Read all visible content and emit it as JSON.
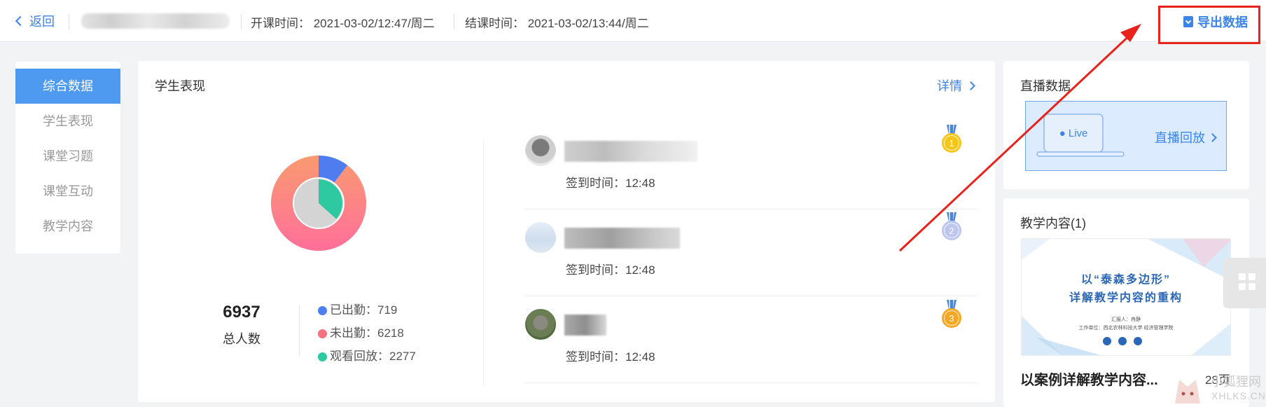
{
  "header": {
    "back_label": "返回",
    "start_time": "开课时间： 2021-03-02/12:47/周二",
    "end_time": "结课时间： 2021-03-02/13:44/周二",
    "export_label": "导出数据"
  },
  "sidebar": {
    "items": [
      {
        "label": "综合数据",
        "active": true
      },
      {
        "label": "学生表现",
        "active": false
      },
      {
        "label": "课堂习题",
        "active": false
      },
      {
        "label": "课堂互动",
        "active": false
      },
      {
        "label": "教学内容",
        "active": false
      }
    ]
  },
  "performance": {
    "title": "学生表现",
    "detail_label": "详情",
    "total_count": "6937",
    "total_label": "总人数",
    "legend": [
      {
        "label": "已出勤：719",
        "color": "#4f7df0"
      },
      {
        "label": "未出勤：6218",
        "color": "#f4727f"
      },
      {
        "label": "观看回放：2277",
        "color": "#2fc9a1"
      }
    ],
    "students": [
      {
        "signin": "签到时间：12:48",
        "rank": "1",
        "medal_color": "#f5c518"
      },
      {
        "signin": "签到时间：12:48",
        "rank": "2",
        "medal_color": "#bcc6ee"
      },
      {
        "signin": "签到时间：12:48",
        "rank": "3",
        "medal_color": "#f5a623"
      }
    ]
  },
  "chart_data": {
    "type": "pie",
    "series": [
      {
        "name": "已出勤",
        "value": 719
      },
      {
        "name": "未出勤",
        "value": 6218
      },
      {
        "name": "观看回放",
        "value": 2277
      }
    ]
  },
  "live": {
    "title": "直播数据",
    "badge": "● Live",
    "replay_label": "直播回放"
  },
  "content": {
    "title": "教学内容(1)",
    "slide_line1": "以“泰森多边形”",
    "slide_line2": "详解教学内容的重构",
    "slide_meta1": "汇报人：冉静",
    "slide_meta2": "工作单位：西北农林科技大学 经济管理学院",
    "course_name": "以案例详解教学内容...",
    "pages": "28页"
  },
  "watermark": {
    "line1": "小狐狸网",
    "line2": "XHLKS.CN"
  }
}
